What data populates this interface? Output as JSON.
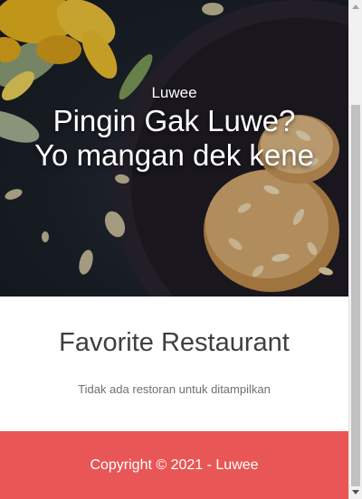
{
  "hero": {
    "brand": "Luwee",
    "title_line1": "Pingin Gak Luwe?",
    "title_line2": "Yo mangan dek kene",
    "image_icon": "food-photo-image"
  },
  "main": {
    "section_title": "Favorite Restaurant",
    "empty_message": "Tidak ada restoran untuk ditampilkan"
  },
  "footer": {
    "copyright": "Copyright © 2021 - Luwee",
    "background_color": "#e85656"
  },
  "colors": {
    "accent": "#e85656",
    "heading_text": "#3f3f3f",
    "muted_text": "#6f6f6f"
  }
}
